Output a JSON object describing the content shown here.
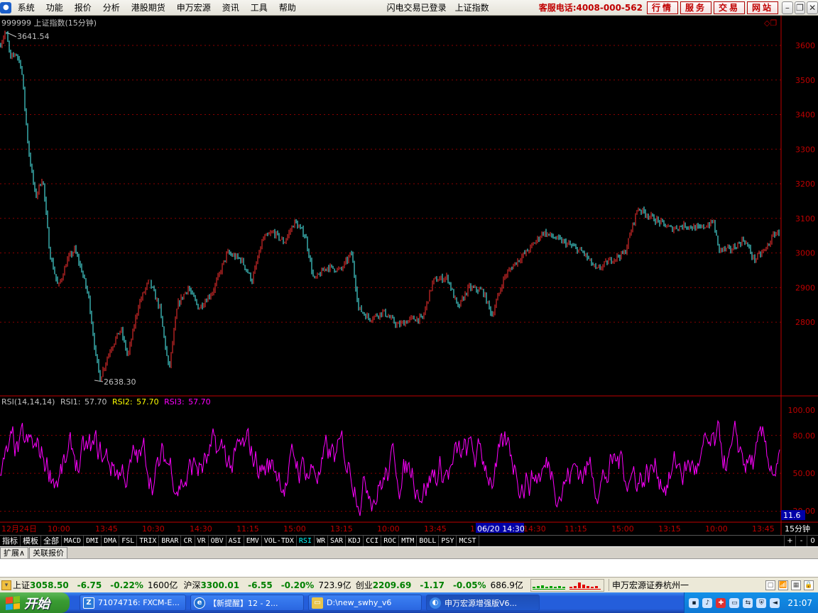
{
  "menubar": {
    "items": [
      "系统",
      "功能",
      "报价",
      "分析",
      "港股期货",
      "申万宏源",
      "资讯",
      "工具",
      "帮助"
    ],
    "login_status": "闪电交易已登录",
    "index_name": "上证指数",
    "hotline": "客服电话:4008-000-562",
    "buttons": [
      "行情",
      "服务",
      "交易",
      "网站"
    ]
  },
  "chart": {
    "title": "999999 上证指数(15分钟)",
    "high_label": "3641.54",
    "low_label": "2638.30",
    "y_ticks": [
      "3600",
      "3500",
      "3400",
      "3300",
      "3200",
      "3100",
      "3000",
      "2900",
      "2800"
    ],
    "rsi_header": {
      "name": "RSI(14,14,14)",
      "rsi1_label": "RSI1:",
      "rsi1_value": "57.70",
      "rsi2_label": "RSI2:",
      "rsi2_value": "57.70",
      "rsi3_label": "RSI3:",
      "rsi3_value": "57.70"
    },
    "rsi_ticks": [
      "100.00",
      "80.00",
      "50.00",
      "20.00"
    ],
    "rsi_current": "11.6",
    "time_labels": [
      "12月24日",
      "10:00",
      "13:45",
      "10:30",
      "14:30",
      "11:15",
      "15:00",
      "13:15",
      "10:00",
      "13:45",
      "1",
      "14:30",
      "11:15",
      "15:00",
      "13:15",
      "10:00",
      "13:45"
    ],
    "cursor_time": "06/20 14:30",
    "period": "15分钟",
    "colors": {
      "up": "#ff3232",
      "down": "#54ffff",
      "rsi": "#ff00ff",
      "grid": "#8b0000",
      "axis": "#c00000",
      "y_label": "#c00000"
    }
  },
  "chart_data": {
    "type": "candlestick",
    "title": "999999 上证指数(15分钟)",
    "y_range": [
      2600,
      3680
    ],
    "high": 3641.54,
    "low": 2638.3,
    "close_path": [
      {
        "x": 0,
        "y": 3600
      },
      {
        "x": 8,
        "y": 3641.54
      },
      {
        "x": 15,
        "y": 3560
      },
      {
        "x": 22,
        "y": 3580
      },
      {
        "x": 30,
        "y": 3540
      },
      {
        "x": 40,
        "y": 3300
      },
      {
        "x": 50,
        "y": 3160
      },
      {
        "x": 60,
        "y": 3220
      },
      {
        "x": 70,
        "y": 3000
      },
      {
        "x": 82,
        "y": 2900
      },
      {
        "x": 95,
        "y": 2980
      },
      {
        "x": 105,
        "y": 3010
      },
      {
        "x": 115,
        "y": 2950
      },
      {
        "x": 125,
        "y": 2870
      },
      {
        "x": 135,
        "y": 2700
      },
      {
        "x": 141,
        "y": 2638.3
      },
      {
        "x": 155,
        "y": 2720
      },
      {
        "x": 170,
        "y": 2780
      },
      {
        "x": 180,
        "y": 2700
      },
      {
        "x": 195,
        "y": 2850
      },
      {
        "x": 210,
        "y": 2920
      },
      {
        "x": 225,
        "y": 2840
      },
      {
        "x": 238,
        "y": 2660
      },
      {
        "x": 250,
        "y": 2850
      },
      {
        "x": 265,
        "y": 2900
      },
      {
        "x": 280,
        "y": 2840
      },
      {
        "x": 300,
        "y": 2890
      },
      {
        "x": 320,
        "y": 3000
      },
      {
        "x": 340,
        "y": 2980
      },
      {
        "x": 355,
        "y": 2920
      },
      {
        "x": 370,
        "y": 3040
      },
      {
        "x": 385,
        "y": 3060
      },
      {
        "x": 400,
        "y": 3030
      },
      {
        "x": 415,
        "y": 3090
      },
      {
        "x": 430,
        "y": 3050
      },
      {
        "x": 442,
        "y": 2920
      },
      {
        "x": 460,
        "y": 2960
      },
      {
        "x": 480,
        "y": 2950
      },
      {
        "x": 495,
        "y": 3000
      },
      {
        "x": 505,
        "y": 2840
      },
      {
        "x": 520,
        "y": 2810
      },
      {
        "x": 540,
        "y": 2830
      },
      {
        "x": 560,
        "y": 2790
      },
      {
        "x": 580,
        "y": 2810
      },
      {
        "x": 595,
        "y": 2810
      },
      {
        "x": 610,
        "y": 2920
      },
      {
        "x": 630,
        "y": 2930
      },
      {
        "x": 645,
        "y": 2840
      },
      {
        "x": 660,
        "y": 2900
      },
      {
        "x": 680,
        "y": 2890
      },
      {
        "x": 693,
        "y": 2820
      },
      {
        "x": 710,
        "y": 2930
      },
      {
        "x": 725,
        "y": 2970
      },
      {
        "x": 745,
        "y": 3010
      },
      {
        "x": 765,
        "y": 3060
      },
      {
        "x": 785,
        "y": 3040
      },
      {
        "x": 805,
        "y": 3020
      },
      {
        "x": 822,
        "y": 3000
      },
      {
        "x": 840,
        "y": 2950
      },
      {
        "x": 860,
        "y": 2980
      },
      {
        "x": 880,
        "y": 3000
      },
      {
        "x": 898,
        "y": 3130
      },
      {
        "x": 920,
        "y": 3100
      },
      {
        "x": 945,
        "y": 3070
      },
      {
        "x": 965,
        "y": 3080
      },
      {
        "x": 985,
        "y": 3070
      },
      {
        "x": 1005,
        "y": 3090
      },
      {
        "x": 1012,
        "y": 3010
      },
      {
        "x": 1030,
        "y": 3010
      },
      {
        "x": 1048,
        "y": 3040
      },
      {
        "x": 1062,
        "y": 2980
      },
      {
        "x": 1078,
        "y": 3010
      },
      {
        "x": 1092,
        "y": 3060
      },
      {
        "x": 1098,
        "y": 3055
      }
    ],
    "rsi": {
      "name": "RSI(14,14,14)",
      "rsi1": 57.7,
      "rsi2": 57.7,
      "rsi3": 57.7,
      "y_range": [
        10,
        100
      ]
    }
  },
  "indicators": {
    "tabs": [
      "指标",
      "模板",
      "全部",
      "MACD",
      "DMI",
      "DMA",
      "FSL",
      "TRIX",
      "BRAR",
      "CR",
      "VR",
      "OBV",
      "ASI",
      "EMV",
      "VOL-TDX",
      "RSI",
      "WR",
      "SAR",
      "KDJ",
      "CCI",
      "ROC",
      "MTM",
      "BOLL",
      "PSY",
      "MCST"
    ],
    "active": "RSI",
    "controls": [
      "+",
      "-",
      "0"
    ]
  },
  "ext_tabs": [
    "扩展∧",
    "关联报价"
  ],
  "status": {
    "sh_label": "上证",
    "sh_value": "3058.50",
    "sh_change": "-6.75",
    "sh_pct": "-0.22%",
    "sh_amount": "1600亿",
    "hs_label": "沪深",
    "hs_value": "3300.01",
    "hs_change": "-6.55",
    "hs_pct": "-0.20%",
    "hs_amount": "723.9亿",
    "cy_label": "创业",
    "cy_value": "2209.69",
    "cy_change": "-1.17",
    "cy_pct": "-0.05%",
    "cy_amount": "686.9亿",
    "broker": "申万宏源证券杭州一"
  },
  "taskbar": {
    "start_label": "开始",
    "tasks": [
      {
        "label": "71074716: FXCM-E...",
        "icon_color": "#2a7ad8"
      },
      {
        "label": "【新提醒】12 - 2...",
        "icon_color": "#1f6fd0"
      },
      {
        "label": "D:\\new_swhy_v6",
        "icon_color": "#e8c44a"
      },
      {
        "label": "申万宏源增强版V6...",
        "icon_color": "#3a86e8"
      }
    ],
    "clock": "21:07"
  }
}
